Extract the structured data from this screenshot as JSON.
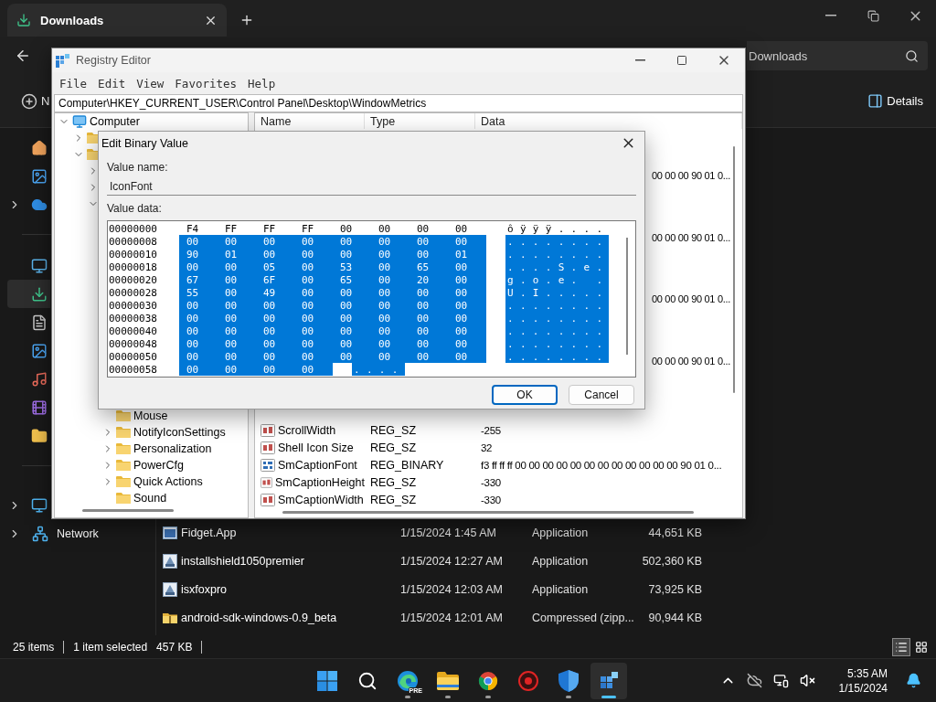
{
  "explorer": {
    "tab": {
      "title": "Downloads"
    },
    "search": {
      "placeholder": "Downloads"
    },
    "command_bar": {
      "new_label": "N",
      "details_label": "Details"
    },
    "nav": {
      "groups": [
        [
          {
            "kind": "home",
            "selected": false,
            "expandable": false
          },
          {
            "kind": "gallery",
            "selected": false,
            "expandable": false
          },
          {
            "kind": "onedrive",
            "selected": false,
            "expandable": true
          }
        ],
        [
          {
            "kind": "desktop",
            "selected": false,
            "expandable": false
          },
          {
            "kind": "downloads",
            "selected": true,
            "expandable": false
          },
          {
            "kind": "documents",
            "selected": false,
            "expandable": false
          },
          {
            "kind": "pictures",
            "selected": false,
            "expandable": false
          },
          {
            "kind": "music",
            "selected": false,
            "expandable": false
          },
          {
            "kind": "videos",
            "selected": false,
            "expandable": false
          },
          {
            "kind": "folder",
            "selected": false,
            "expandable": false
          }
        ],
        [
          {
            "kind": "this_pc",
            "selected": false,
            "expandable": true
          },
          {
            "kind": "network",
            "label": "Network",
            "selected": false,
            "expandable": true
          }
        ]
      ]
    },
    "files": [
      {
        "kind": "app",
        "name": "Fidget.App",
        "date": "1/15/2024 1:45 AM",
        "type": "Application",
        "size": "44,651 KB"
      },
      {
        "kind": "installer",
        "name": "installshield1050premier",
        "date": "1/15/2024 12:27 AM",
        "type": "Application",
        "size": "502,360 KB"
      },
      {
        "kind": "installer",
        "name": "isxfoxpro",
        "date": "1/15/2024 12:03 AM",
        "type": "Application",
        "size": "73,925 KB"
      },
      {
        "kind": "zip",
        "name": "android-sdk-windows-0.9_beta",
        "date": "1/15/2024 12:01 AM",
        "type": "Compressed (zipp...",
        "size": "90,944 KB"
      }
    ],
    "status_bar": {
      "count": "25 items",
      "selection": "1 item selected",
      "size": "457 KB",
      "views": [
        {
          "kind": "details",
          "selected": true
        },
        {
          "kind": "tiles",
          "selected": false
        }
      ]
    }
  },
  "registry": {
    "title": "Registry Editor",
    "menu": [
      "File",
      "Edit",
      "View",
      "Favorites",
      "Help"
    ],
    "address": "Computer\\HKEY_CURRENT_USER\\Control Panel\\Desktop\\WindowMetrics",
    "tree": [
      {
        "kind": "computer",
        "label": "Computer",
        "expanded": true,
        "children": [
          {
            "expanded": false
          },
          {
            "expanded": true,
            "children": [
              {
                "expanded": false
              },
              {
                "expanded": false
              },
              {
                "expanded": true,
                "children": [
                  {
                    "label": "Mouse"
                  },
                  {
                    "label": "NotifyIconSettings",
                    "expanded": false
                  },
                  {
                    "label": "Personalization",
                    "expanded": false
                  },
                  {
                    "label": "PowerCfg",
                    "expanded": false
                  },
                  {
                    "label": "Quick Actions",
                    "expanded": false
                  },
                  {
                    "label": "Sound"
                  }
                ]
              }
            ]
          }
        ]
      }
    ],
    "columns": [
      "Name",
      "Type",
      "Data"
    ],
    "covered_values": [
      {
        "data": "00 00 00 90 01 0..."
      },
      {
        "data": "00 00 00 90 01 0..."
      },
      {
        "data": "00 00 00 90 01 0..."
      },
      {
        "data": "00 00 00 90 01 0..."
      }
    ],
    "values": [
      {
        "kind": "string",
        "name": "ScrollWidth",
        "type": "REG_SZ",
        "data": "-255"
      },
      {
        "kind": "string",
        "name": "Shell Icon Size",
        "type": "REG_SZ",
        "data": "32"
      },
      {
        "kind": "binary",
        "name": "SmCaptionFont",
        "type": "REG_BINARY",
        "data": "f3 ff ff ff 00 00 00 00 00 00 00 00 00 00 00 00 90 01 0..."
      },
      {
        "kind": "string",
        "name": "SmCaptionHeight",
        "type": "REG_SZ",
        "data": "-330"
      },
      {
        "kind": "string",
        "name": "SmCaptionWidth",
        "type": "REG_SZ",
        "data": "-330"
      }
    ]
  },
  "dialog": {
    "title": "Edit Binary Value",
    "value_name_label": "Value name:",
    "value_name": "IconFont",
    "value_data_label": "Value data:",
    "rows": [
      {
        "address": "00000000",
        "bytes": [
          "F4",
          "FF",
          "FF",
          "FF",
          "00",
          "00",
          "00",
          "00"
        ],
        "ascii": "ôÿÿÿ....",
        "selected": false
      },
      {
        "address": "00000008",
        "bytes": [
          "00",
          "00",
          "00",
          "00",
          "00",
          "00",
          "00",
          "00"
        ],
        "ascii": "........",
        "selected": true
      },
      {
        "address": "00000010",
        "bytes": [
          "90",
          "01",
          "00",
          "00",
          "00",
          "00",
          "00",
          "01"
        ],
        "ascii": "........",
        "selected": true
      },
      {
        "address": "00000018",
        "bytes": [
          "00",
          "00",
          "05",
          "00",
          "53",
          "00",
          "65",
          "00"
        ],
        "ascii": "....S.e.",
        "selected": true
      },
      {
        "address": "00000020",
        "bytes": [
          "67",
          "00",
          "6F",
          "00",
          "65",
          "00",
          "20",
          "00"
        ],
        "ascii": "g.o.e. .",
        "selected": true
      },
      {
        "address": "00000028",
        "bytes": [
          "55",
          "00",
          "49",
          "00",
          "00",
          "00",
          "00",
          "00"
        ],
        "ascii": "U.I.....",
        "selected": true
      },
      {
        "address": "00000030",
        "bytes": [
          "00",
          "00",
          "00",
          "00",
          "00",
          "00",
          "00",
          "00"
        ],
        "ascii": "........",
        "selected": true
      },
      {
        "address": "00000038",
        "bytes": [
          "00",
          "00",
          "00",
          "00",
          "00",
          "00",
          "00",
          "00"
        ],
        "ascii": "........",
        "selected": true
      },
      {
        "address": "00000040",
        "bytes": [
          "00",
          "00",
          "00",
          "00",
          "00",
          "00",
          "00",
          "00"
        ],
        "ascii": "........",
        "selected": true
      },
      {
        "address": "00000048",
        "bytes": [
          "00",
          "00",
          "00",
          "00",
          "00",
          "00",
          "00",
          "00"
        ],
        "ascii": "........",
        "selected": true
      },
      {
        "address": "00000050",
        "bytes": [
          "00",
          "00",
          "00",
          "00",
          "00",
          "00",
          "00",
          "00"
        ],
        "ascii": "........",
        "selected": true
      },
      {
        "address": "00000058",
        "bytes": [
          "00",
          "00",
          "00",
          "00"
        ],
        "ascii": "....",
        "selected": true
      }
    ],
    "buttons": [
      {
        "label": "OK",
        "default": true
      },
      {
        "label": "Cancel",
        "default": false
      }
    ]
  },
  "taskbar": {
    "apps": [
      {
        "kind": "start",
        "running": false,
        "selected": false
      },
      {
        "kind": "search",
        "running": false,
        "selected": false
      },
      {
        "kind": "edge",
        "badge": "PRE",
        "running": true,
        "selected": false
      },
      {
        "kind": "explorer",
        "running": true,
        "selected": false
      },
      {
        "kind": "chrome",
        "running": true,
        "selected": false
      },
      {
        "kind": "red_app",
        "running": false,
        "selected": false
      },
      {
        "kind": "defender",
        "running": true,
        "selected": false
      },
      {
        "kind": "regedit",
        "running": true,
        "selected": true
      }
    ],
    "clock": {
      "time": "5:35 AM",
      "date": "1/15/2024"
    }
  }
}
